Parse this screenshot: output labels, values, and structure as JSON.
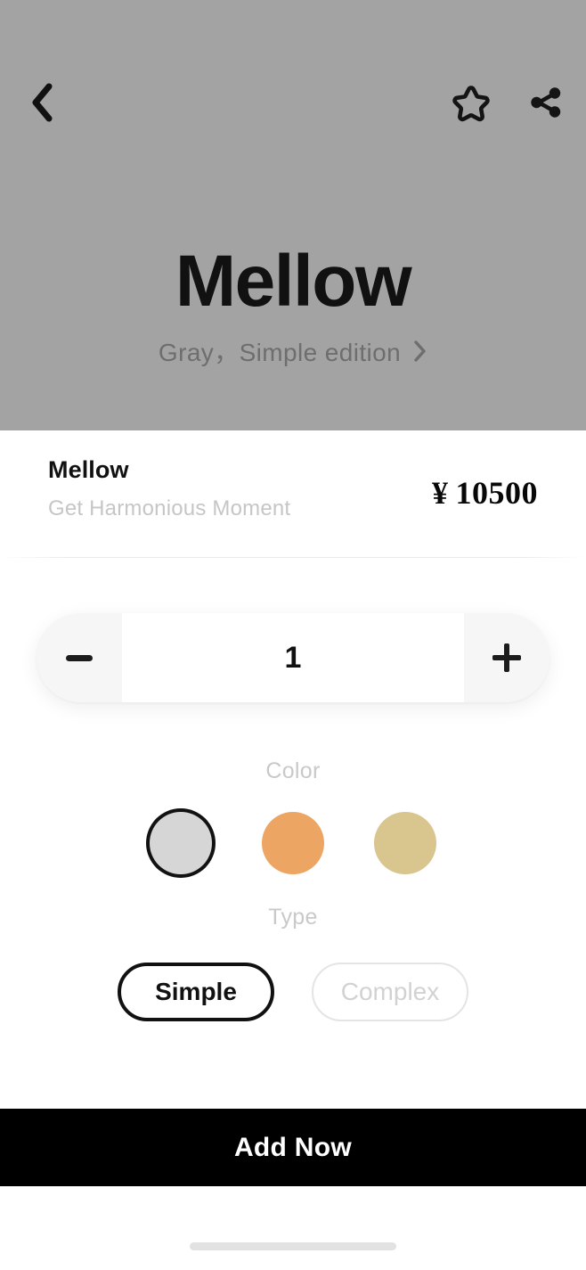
{
  "hero": {
    "background_color": "#a3a3a3",
    "back_icon": "chevron-left-icon",
    "favorite_icon": "star-outline-icon",
    "share_icon": "share-icon",
    "title": "Mellow",
    "subtitle": "Gray，Simple edition",
    "subtitle_chevron_icon": "chevron-right-icon"
  },
  "product": {
    "name": "Mellow",
    "tagline": "Get Harmonious Moment",
    "currency": "¥",
    "price": "10500"
  },
  "stepper": {
    "decrease_icon": "minus-icon",
    "increase_icon": "plus-icon",
    "quantity": "1"
  },
  "options": {
    "color": {
      "label": "Color",
      "swatches": [
        {
          "name": "gray",
          "hex": "#d6d6d6",
          "selected": true
        },
        {
          "name": "orange",
          "hex": "#eda563",
          "selected": false
        },
        {
          "name": "tan",
          "hex": "#d9c58e",
          "selected": false
        }
      ]
    },
    "type": {
      "label": "Type",
      "choices": [
        {
          "label": "Simple",
          "selected": true
        },
        {
          "label": "Complex",
          "selected": false
        }
      ]
    }
  },
  "cta": {
    "label": "Add Now",
    "background_color": "#000000",
    "text_color": "#ffffff"
  }
}
